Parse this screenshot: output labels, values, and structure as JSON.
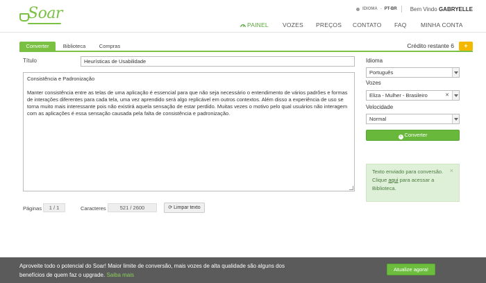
{
  "brand": {
    "name": "Soar"
  },
  "topbar": {
    "language_label": "IDIOMA",
    "language_sep": "-",
    "language_value": "PT-BR",
    "welcome_prefix": "Bem Vindo",
    "user_name": "GABRYELLE"
  },
  "nav": {
    "items": [
      {
        "label": "PAINEL",
        "icon": "dashboard-icon"
      },
      {
        "label": "VOZES"
      },
      {
        "label": "PREÇOS"
      },
      {
        "label": "CONTATO"
      },
      {
        "label": "FAQ"
      },
      {
        "label": "MINHA CONTA"
      }
    ],
    "active_color": "#58a53a"
  },
  "tabs": {
    "items": [
      {
        "label": "Converter"
      },
      {
        "label": "Biblioteca"
      },
      {
        "label": "Compras"
      }
    ],
    "credit_label": "Crédito restante 6",
    "credit_icon": "plus-icon"
  },
  "form": {
    "title_label": "Título",
    "title_value": "Heurísticas de Usabilidade",
    "body_heading": "Consistência e Padronização",
    "body_text": "Manter consistência entre as telas de uma aplicação é essencial para que não seja necessário o entendimento de vários padrões e formas de interações diferentes para cada tela, uma vez aprendido será algo replicável em outros contextos. Além disso a experiência de uso se torna muito mais interessante pois não existirá aquela sensação de estar perdido. Muitas vezes o motivo pelo qual usuários não interagem com as aplicações é essa sensação causada pela falta de consistência e padronização.",
    "pages_label": "Páginas",
    "pages_value": "1 / 1",
    "chars_label": "Caracteres",
    "chars_value": "521 / 2600",
    "clear_button": "Limpar texto"
  },
  "settings": {
    "language_label": "Idioma",
    "language_value": "Português",
    "voices_label": "Vozes",
    "voice_value": "Eliza - Mulher - Brasileiro",
    "speed_label": "Velocidade",
    "speed_value": "Normal",
    "convert_button": "Converter"
  },
  "notice": {
    "text_before": "Texto enviado para conversão. Clique ",
    "link": "aqui",
    "text_after": " para acessar a Biblioteca.",
    "close": "×"
  },
  "banner": {
    "text": "Aproveite todo o potencial do Soar! Maior limite de conversão, mais vozes de alta qualidade são alguns dos benefícios de quem faz o upgrade.",
    "link": "Saiba mais",
    "button": "Atualize agora!"
  },
  "colors": {
    "brand_green": "#7ac143",
    "button_green": "#68b83b",
    "credit_yellow": "#f5b800",
    "banner_bg": "#5b5b5b"
  }
}
